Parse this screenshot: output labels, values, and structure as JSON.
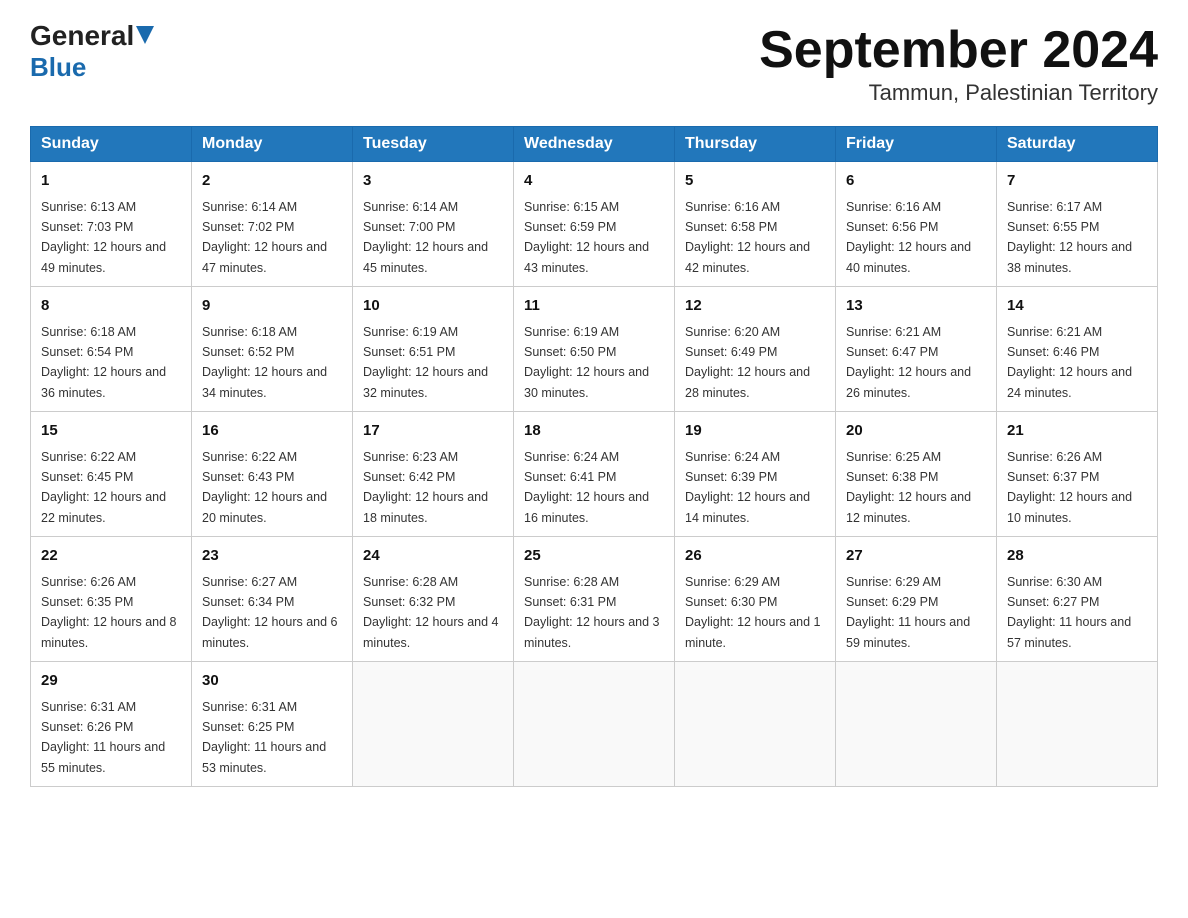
{
  "header": {
    "title": "September 2024",
    "subtitle": "Tammun, Palestinian Territory",
    "logo_top": "General",
    "logo_bottom": "Blue"
  },
  "days_of_week": [
    "Sunday",
    "Monday",
    "Tuesday",
    "Wednesday",
    "Thursday",
    "Friday",
    "Saturday"
  ],
  "weeks": [
    [
      {
        "day": "1",
        "sunrise": "6:13 AM",
        "sunset": "7:03 PM",
        "daylight": "12 hours and 49 minutes."
      },
      {
        "day": "2",
        "sunrise": "6:14 AM",
        "sunset": "7:02 PM",
        "daylight": "12 hours and 47 minutes."
      },
      {
        "day": "3",
        "sunrise": "6:14 AM",
        "sunset": "7:00 PM",
        "daylight": "12 hours and 45 minutes."
      },
      {
        "day": "4",
        "sunrise": "6:15 AM",
        "sunset": "6:59 PM",
        "daylight": "12 hours and 43 minutes."
      },
      {
        "day": "5",
        "sunrise": "6:16 AM",
        "sunset": "6:58 PM",
        "daylight": "12 hours and 42 minutes."
      },
      {
        "day": "6",
        "sunrise": "6:16 AM",
        "sunset": "6:56 PM",
        "daylight": "12 hours and 40 minutes."
      },
      {
        "day": "7",
        "sunrise": "6:17 AM",
        "sunset": "6:55 PM",
        "daylight": "12 hours and 38 minutes."
      }
    ],
    [
      {
        "day": "8",
        "sunrise": "6:18 AM",
        "sunset": "6:54 PM",
        "daylight": "12 hours and 36 minutes."
      },
      {
        "day": "9",
        "sunrise": "6:18 AM",
        "sunset": "6:52 PM",
        "daylight": "12 hours and 34 minutes."
      },
      {
        "day": "10",
        "sunrise": "6:19 AM",
        "sunset": "6:51 PM",
        "daylight": "12 hours and 32 minutes."
      },
      {
        "day": "11",
        "sunrise": "6:19 AM",
        "sunset": "6:50 PM",
        "daylight": "12 hours and 30 minutes."
      },
      {
        "day": "12",
        "sunrise": "6:20 AM",
        "sunset": "6:49 PM",
        "daylight": "12 hours and 28 minutes."
      },
      {
        "day": "13",
        "sunrise": "6:21 AM",
        "sunset": "6:47 PM",
        "daylight": "12 hours and 26 minutes."
      },
      {
        "day": "14",
        "sunrise": "6:21 AM",
        "sunset": "6:46 PM",
        "daylight": "12 hours and 24 minutes."
      }
    ],
    [
      {
        "day": "15",
        "sunrise": "6:22 AM",
        "sunset": "6:45 PM",
        "daylight": "12 hours and 22 minutes."
      },
      {
        "day": "16",
        "sunrise": "6:22 AM",
        "sunset": "6:43 PM",
        "daylight": "12 hours and 20 minutes."
      },
      {
        "day": "17",
        "sunrise": "6:23 AM",
        "sunset": "6:42 PM",
        "daylight": "12 hours and 18 minutes."
      },
      {
        "day": "18",
        "sunrise": "6:24 AM",
        "sunset": "6:41 PM",
        "daylight": "12 hours and 16 minutes."
      },
      {
        "day": "19",
        "sunrise": "6:24 AM",
        "sunset": "6:39 PM",
        "daylight": "12 hours and 14 minutes."
      },
      {
        "day": "20",
        "sunrise": "6:25 AM",
        "sunset": "6:38 PM",
        "daylight": "12 hours and 12 minutes."
      },
      {
        "day": "21",
        "sunrise": "6:26 AM",
        "sunset": "6:37 PM",
        "daylight": "12 hours and 10 minutes."
      }
    ],
    [
      {
        "day": "22",
        "sunrise": "6:26 AM",
        "sunset": "6:35 PM",
        "daylight": "12 hours and 8 minutes."
      },
      {
        "day": "23",
        "sunrise": "6:27 AM",
        "sunset": "6:34 PM",
        "daylight": "12 hours and 6 minutes."
      },
      {
        "day": "24",
        "sunrise": "6:28 AM",
        "sunset": "6:32 PM",
        "daylight": "12 hours and 4 minutes."
      },
      {
        "day": "25",
        "sunrise": "6:28 AM",
        "sunset": "6:31 PM",
        "daylight": "12 hours and 3 minutes."
      },
      {
        "day": "26",
        "sunrise": "6:29 AM",
        "sunset": "6:30 PM",
        "daylight": "12 hours and 1 minute."
      },
      {
        "day": "27",
        "sunrise": "6:29 AM",
        "sunset": "6:29 PM",
        "daylight": "11 hours and 59 minutes."
      },
      {
        "day": "28",
        "sunrise": "6:30 AM",
        "sunset": "6:27 PM",
        "daylight": "11 hours and 57 minutes."
      }
    ],
    [
      {
        "day": "29",
        "sunrise": "6:31 AM",
        "sunset": "6:26 PM",
        "daylight": "11 hours and 55 minutes."
      },
      {
        "day": "30",
        "sunrise": "6:31 AM",
        "sunset": "6:25 PM",
        "daylight": "11 hours and 53 minutes."
      },
      null,
      null,
      null,
      null,
      null
    ]
  ],
  "labels": {
    "sunrise": "Sunrise:",
    "sunset": "Sunset:",
    "daylight": "Daylight:"
  }
}
